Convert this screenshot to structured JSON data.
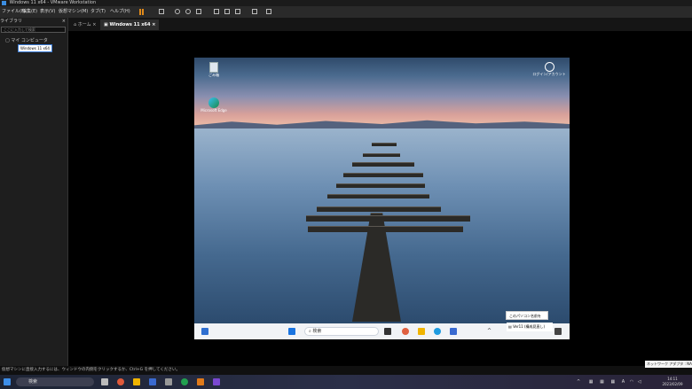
{
  "window": {
    "title": "Windows 11 x64 - VMware Workstation"
  },
  "menu": {
    "items": [
      "ファイル(F)",
      "編集(E)",
      "表示(V)",
      "仮想マシン(M)",
      "タブ(T)",
      "ヘルプ(H)"
    ]
  },
  "library": {
    "title": "ライブラリ",
    "search_placeholder": "ここに入力して検索",
    "tree_root": "マイ コンピュータ",
    "tree_vm": "Windows 11 x64"
  },
  "tabs": [
    {
      "label": "ホーム"
    },
    {
      "label": "Windows 11 x64"
    }
  ],
  "guest": {
    "recycle_label": "ごみ箱",
    "edge_label": "Microsoft Edge",
    "user_icon_label": "ログイン/アカウント",
    "search_label": "検索",
    "notification_1": "このパソコン名前を",
    "notification_2": "Ver11 (構成見直し)"
  },
  "status_text": "仮想マシンに直接入力するには、ウィンドウの内側をクリックするか、Ctrl+G を押してください。",
  "tooltip_text": "ネットワーク アダプタ : NA",
  "host_taskbar": {
    "search_label": "検索",
    "time": "14:11",
    "date": "2023/02/09"
  },
  "colors": {
    "accent": "#3b8de0",
    "pause": "#e08a1a"
  }
}
